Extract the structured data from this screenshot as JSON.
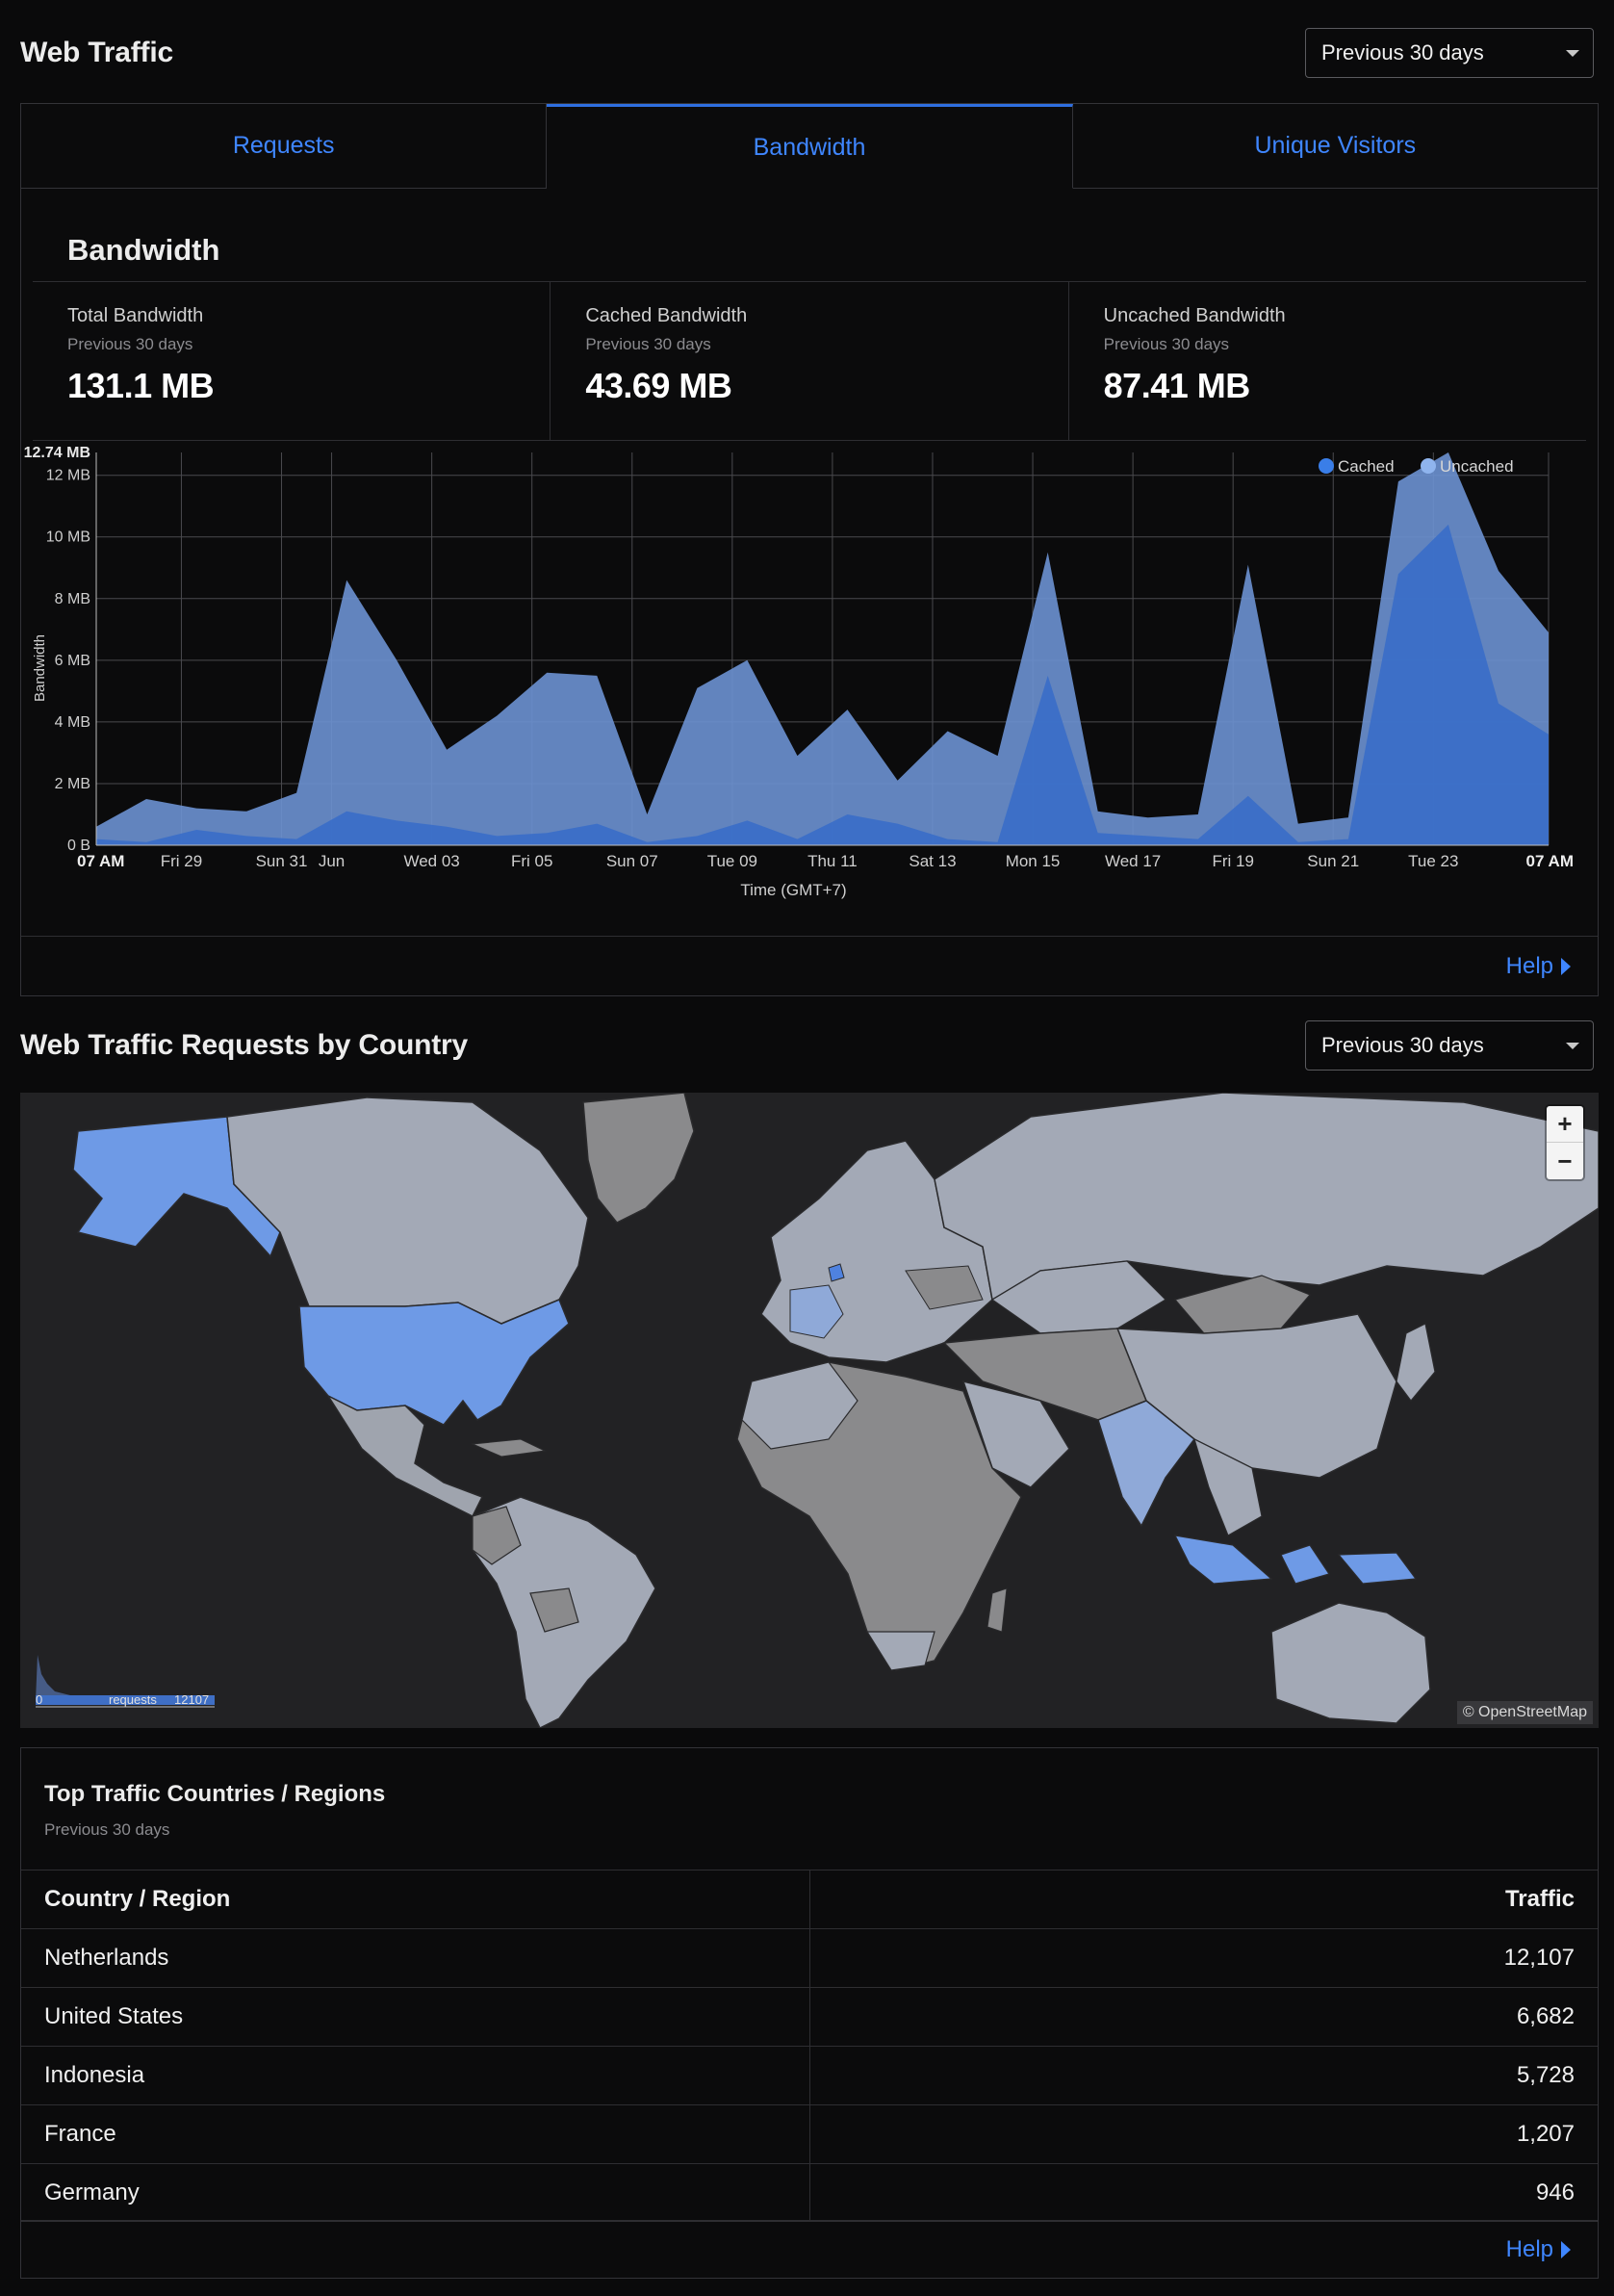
{
  "header": {
    "title": "Web Traffic",
    "range": "Previous 30 days"
  },
  "tabs": [
    {
      "label": "Requests",
      "active": false
    },
    {
      "label": "Bandwidth",
      "active": true
    },
    {
      "label": "Unique Visitors",
      "active": false
    }
  ],
  "bandwidth": {
    "title": "Bandwidth",
    "stats": [
      {
        "label": "Total Bandwidth",
        "sub": "Previous 30 days",
        "value": "131.1 MB"
      },
      {
        "label": "Cached Bandwidth",
        "sub": "Previous 30 days",
        "value": "43.69 MB"
      },
      {
        "label": "Uncached Bandwidth",
        "sub": "Previous 30 days",
        "value": "87.41 MB"
      }
    ],
    "help": "Help"
  },
  "chart_data": {
    "type": "area",
    "xlabel": "Time (GMT+7)",
    "ylabel": "Bandwidth",
    "ylim": [
      0,
      12.74
    ],
    "max_label": "12.74 MB",
    "y_ticks": [
      "0 B",
      "2 MB",
      "4 MB",
      "6 MB",
      "8 MB",
      "10 MB",
      "12 MB"
    ],
    "x_ticks": [
      {
        "label": "07 AM",
        "x": 0,
        "bold": true
      },
      {
        "label": "Fri 29",
        "x": 1.7
      },
      {
        "label": "Sun 31",
        "x": 3.7
      },
      {
        "label": "Jun",
        "x": 4.7
      },
      {
        "label": "Wed 03",
        "x": 6.7
      },
      {
        "label": "Fri 05",
        "x": 8.7
      },
      {
        "label": "Sun 07",
        "x": 10.7
      },
      {
        "label": "Tue 09",
        "x": 12.7
      },
      {
        "label": "Thu 11",
        "x": 14.7
      },
      {
        "label": "Sat 13",
        "x": 16.7
      },
      {
        "label": "Mon 15",
        "x": 18.7
      },
      {
        "label": "Wed 17",
        "x": 20.7
      },
      {
        "label": "Fri 19",
        "x": 22.7
      },
      {
        "label": "Sun 21",
        "x": 24.7
      },
      {
        "label": "Tue 23",
        "x": 26.7
      },
      {
        "label": "07 AM",
        "x": 29,
        "bold": true
      }
    ],
    "x": [
      0,
      1,
      2,
      3,
      4,
      5,
      6,
      7,
      8,
      9,
      10,
      11,
      12,
      13,
      14,
      15,
      16,
      17,
      18,
      19,
      20,
      21,
      22,
      23,
      24,
      25,
      26,
      27,
      28,
      29
    ],
    "series": [
      {
        "name": "Uncached",
        "color": "#6a8fce",
        "values": [
          0.6,
          1.5,
          1.2,
          1.1,
          1.7,
          8.6,
          6.0,
          3.1,
          4.2,
          5.6,
          5.5,
          1.0,
          5.1,
          6.0,
          2.9,
          4.4,
          2.1,
          3.7,
          2.9,
          9.5,
          1.1,
          0.9,
          1.0,
          9.1,
          0.7,
          0.9,
          11.8,
          12.74,
          8.9,
          6.9
        ]
      },
      {
        "name": "Cached",
        "color": "#3a6ec8",
        "values": [
          0.2,
          0.1,
          0.5,
          0.3,
          0.2,
          1.1,
          0.8,
          0.6,
          0.3,
          0.4,
          0.7,
          0.1,
          0.3,
          0.8,
          0.2,
          1.0,
          0.7,
          0.2,
          0.1,
          5.5,
          0.4,
          0.3,
          0.2,
          1.6,
          0.1,
          0.2,
          8.8,
          10.4,
          4.6,
          3.6
        ]
      }
    ],
    "legend": [
      "Cached",
      "Uncached"
    ],
    "legend_colors": [
      "#3a7ee8",
      "#8fb4ee"
    ]
  },
  "map_section": {
    "title": "Web Traffic Requests by Country",
    "range": "Previous 30 days",
    "zoom_in": "+",
    "zoom_out": "−",
    "attribution": "© OpenStreetMap",
    "legend_min": "0",
    "legend_label": "requests",
    "legend_max": "12107"
  },
  "top_countries": {
    "title": "Top Traffic Countries / Regions",
    "sub": "Previous 30 days",
    "columns": [
      "Country / Region",
      "Traffic"
    ],
    "rows": [
      [
        "Netherlands",
        "12,107"
      ],
      [
        "United States",
        "6,682"
      ],
      [
        "Indonesia",
        "5,728"
      ],
      [
        "France",
        "1,207"
      ],
      [
        "Germany",
        "946"
      ]
    ],
    "help": "Help"
  }
}
